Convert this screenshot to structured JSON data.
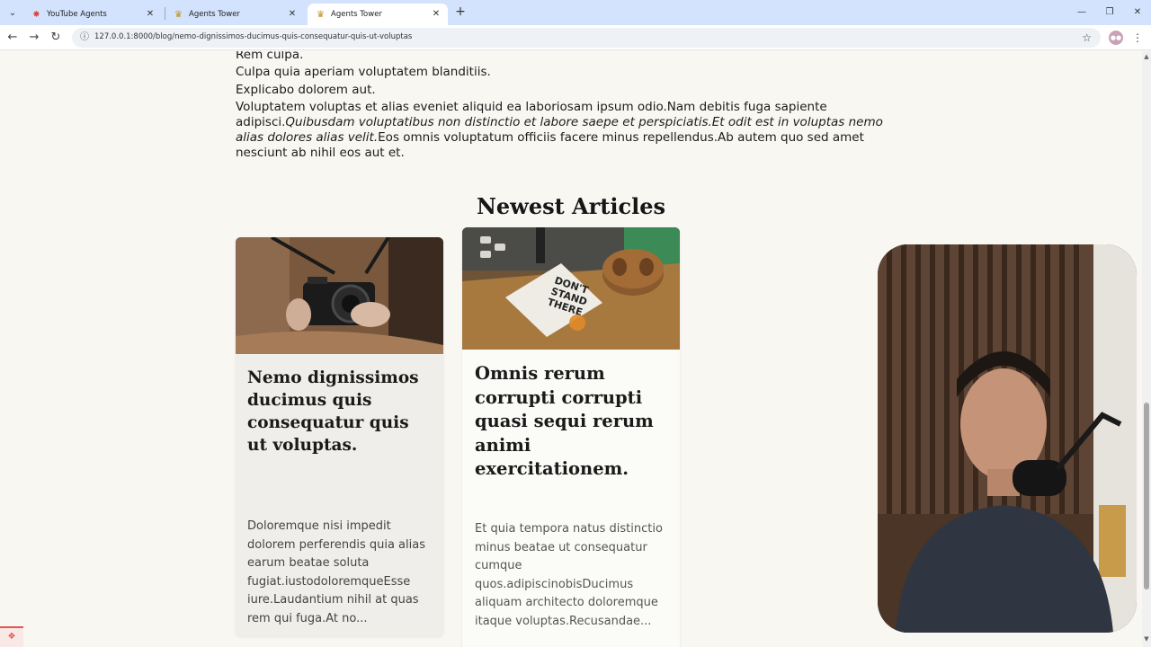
{
  "browser": {
    "tabs": [
      {
        "title": "YouTube Agents",
        "favicon": "burst-icon",
        "active": false
      },
      {
        "title": "Agents Tower",
        "favicon": "tower-icon",
        "active": false
      },
      {
        "title": "Agents Tower",
        "favicon": "tower-icon",
        "active": true
      }
    ],
    "url": "127.0.0.1:8000/blog/nemo-dignissimos-ducimus-quis-consequatur-quis-ut-voluptas"
  },
  "article": {
    "lines": [
      "Rem culpa.",
      "Culpa quia aperiam voluptatem blanditiis.",
      "Explicabo dolorem aut."
    ],
    "paragraph": {
      "part1": "Voluptatem voluptas et alias eveniet aliquid ea laboriosam ipsum odio.Nam debitis fuga sapiente adipisci.",
      "part2_italic": "Quibusdam voluptatibus non distinctio et labore saepe et perspiciatis.Et odit est in voluptas nemo alias dolores alias velit.",
      "part3": "Eos omnis voluptatum officiis facere minus repellendus.Ab autem quo sed amet nesciunt ab nihil eos aut et."
    }
  },
  "newest": {
    "heading": "Newest Articles",
    "cards": [
      {
        "title": "Nemo dignissimos ducimus quis consequatur quis ut voluptas.",
        "excerpt": "Doloremque nisi impedit dolorem perferendis quia alias earum beatae soluta fugiat.iustodoloremqueEsse iure.Laudantium nihil at quas rem qui fuga.At no..."
      },
      {
        "title": "Omnis rerum corrupti corrupti quasi sequi rerum animi exercitationem.",
        "excerpt": "Et quia tempora natus distinctio minus beatae ut consequatur cumque quos.adipiscinobisDucimus aliquam architecto doloremque itaque voluptas.Recusandae..."
      }
    ]
  },
  "image_text": {
    "sign_lines": [
      "DON'T",
      "STAND",
      "THERE"
    ]
  },
  "colors": {
    "page_bg": "#f8f7f2",
    "tabbar_bg": "#d3e3fd",
    "debug_accent": "#e0574d"
  }
}
